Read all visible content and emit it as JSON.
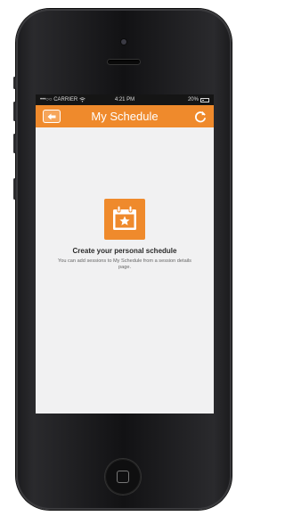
{
  "status_bar": {
    "carrier": "•••○○ CARRIER",
    "wifi_icon": "wifi-icon",
    "time": "4:21 PM",
    "battery_percent": "20%",
    "battery_icon": "battery-icon"
  },
  "nav_bar": {
    "title": "My Schedule",
    "back_icon": "back-arrow-icon",
    "refresh_icon": "refresh-icon"
  },
  "empty_state": {
    "icon": "calendar-star-icon",
    "title": "Create your personal schedule",
    "message": "You can add sessions to My Schedule from a session details page."
  },
  "colors": {
    "accent": "#ef8a2c",
    "background": "#f1f1f2",
    "phone_body": "#151517"
  }
}
